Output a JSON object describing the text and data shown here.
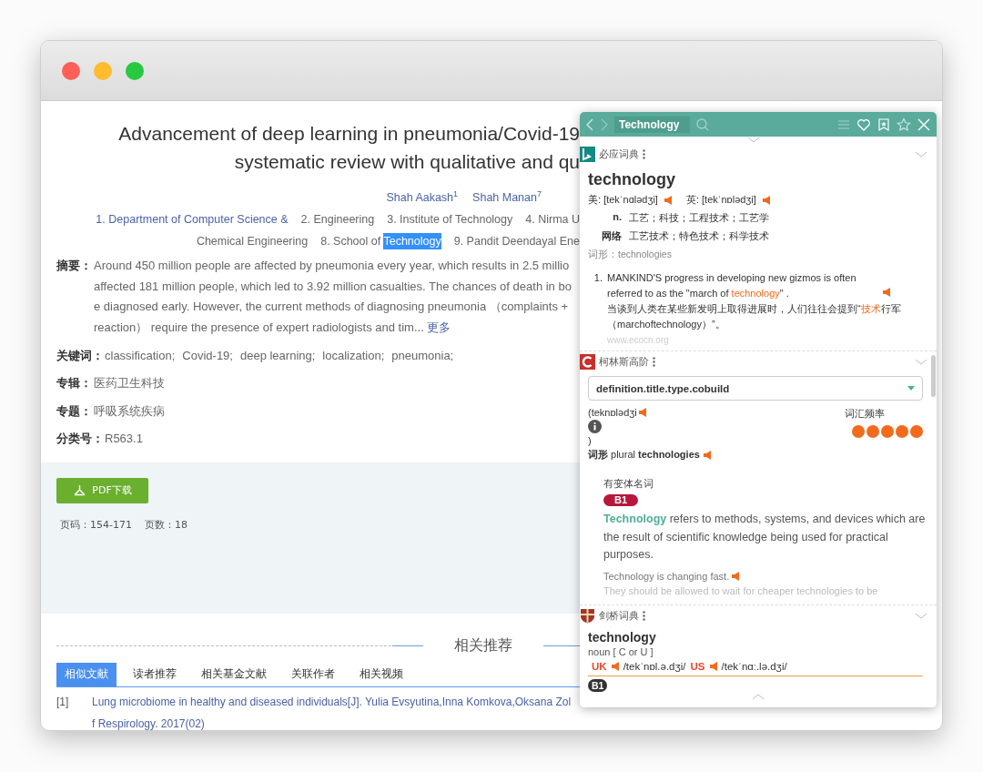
{
  "article": {
    "title_lines": [
      "Advancement of deep learning in pneumonia/Covid-19",
      "systematic review with qualitative and qu"
    ],
    "authors": [
      {
        "name": "Shah Aakash",
        "sup": "1"
      },
      {
        "name": "Shah Manan",
        "sup": "7"
      }
    ],
    "affiliation_rows": [
      [
        {
          "text": "1. Department of Computer Science &",
          "highlighted": true
        },
        {
          "text": "2. Engineering",
          "highlighted": false
        },
        {
          "text": "3. Institute of Technology",
          "highlighted": false
        },
        {
          "text": "4. Nirma U",
          "highlighted": false
        }
      ],
      [
        {
          "text": "Chemical Engineering",
          "highlighted": false
        },
        {
          "text": "8. School of ",
          "selected_text": "Technology",
          "highlighted": false
        },
        {
          "text": "9. Pandit Deendayal Ene",
          "highlighted": false
        }
      ]
    ],
    "abstract": {
      "label": "摘要：",
      "lines": [
        "Around 450 million people are affected by pneumonia every year, which results in 2.5 millio",
        "affected 181 million people, which led to 3.92 million casualties. The chances of death in bo",
        "e diagnosed early. However, the current methods of diagnosing pneumonia （complaints +",
        "reaction） require the presence of expert radiologists and tim..."
      ],
      "more": "更多"
    },
    "keywords": {
      "label": "关键词：",
      "items": [
        "classification;",
        "Covid-19;",
        "deep learning;",
        "localization;",
        "pneumonia;"
      ]
    },
    "fields": [
      {
        "label": "专辑：",
        "value": "医药卫生科技"
      },
      {
        "label": "专题：",
        "value": "呼吸系统疾病"
      },
      {
        "label": "分类号：",
        "value": "R563.1"
      }
    ],
    "download_button": "PDF下载",
    "page_info": [
      "页码：154-171",
      "页数：18"
    ],
    "related": {
      "heading": "相关推荐",
      "tabs": [
        {
          "label": "相似文献",
          "selected": true
        },
        {
          "label": "读者推荐",
          "selected": false
        },
        {
          "label": "相关基金文献",
          "selected": false
        },
        {
          "label": "关联作者",
          "selected": false
        },
        {
          "label": "相关视频",
          "selected": false
        }
      ],
      "references": [
        {
          "index": "[1]",
          "lines": [
            "Lung microbiome in healthy and diseased individuals[J]. Yulia Evsyutina,Inna Komkova,Oksana Zol",
            "f Respirology. 2017(02)"
          ]
        }
      ]
    }
  },
  "dictionary": {
    "search": {
      "value": "Technology"
    },
    "bing": {
      "source": "必应词典",
      "word": "technology",
      "pronunciations": [
        {
          "label": "美:",
          "ipa": "[tekˈnɑlədʒi]"
        },
        {
          "label": "英:",
          "ipa": "[tekˈnɒlədʒi]"
        }
      ],
      "senses": [
        {
          "pos": "n.",
          "text": "工艺；科技；工程技术；工艺学"
        },
        {
          "pos": "网络",
          "text": "工艺技术；特色技术；科学技术"
        }
      ],
      "forms": "词形：technologies",
      "examples": [
        {
          "number": "1.",
          "en_before": "MANKIND'S progress in developing new gizmos is often referred to as the \"march of ",
          "en_highlight": "technology",
          "en_after": "\" .",
          "zh_before": "当谈到人类在某些新发明上取得进展时，人们往往会提到“",
          "zh_highlight": "技术",
          "zh_after": "行军（marchoftechnology）”。",
          "source": "www.ecocn.org"
        }
      ]
    },
    "collins": {
      "source": "柯林斯高阶",
      "select": "definition.title.type.cobuild",
      "pronunciation": "(teknɒlədʒi",
      "close_paren": ")",
      "forms": "**词形** plural **technologies**",
      "frequency_label": "词汇频率",
      "stars": 5,
      "grammar": "有变体名词",
      "level": "B1",
      "headword": "Technology",
      "definition": " refers to methods, systems, and devices which are the result of scientific knowledge being used for practical purposes.",
      "examples": [
        "Technology is changing fast.",
        "They should be allowed to wait for cheaper technologies to be"
      ]
    },
    "cambridge": {
      "source": "剑桥词典",
      "word": "technology",
      "grammar": "noun [ C or U ]",
      "pronunciations": [
        {
          "region": "UK",
          "ipa": "/tekˈnɒl.ə.dʒi/"
        },
        {
          "region": "US",
          "ipa": "/tekˈnɑː.lə.dʒi/"
        }
      ],
      "level": "B1"
    }
  }
}
